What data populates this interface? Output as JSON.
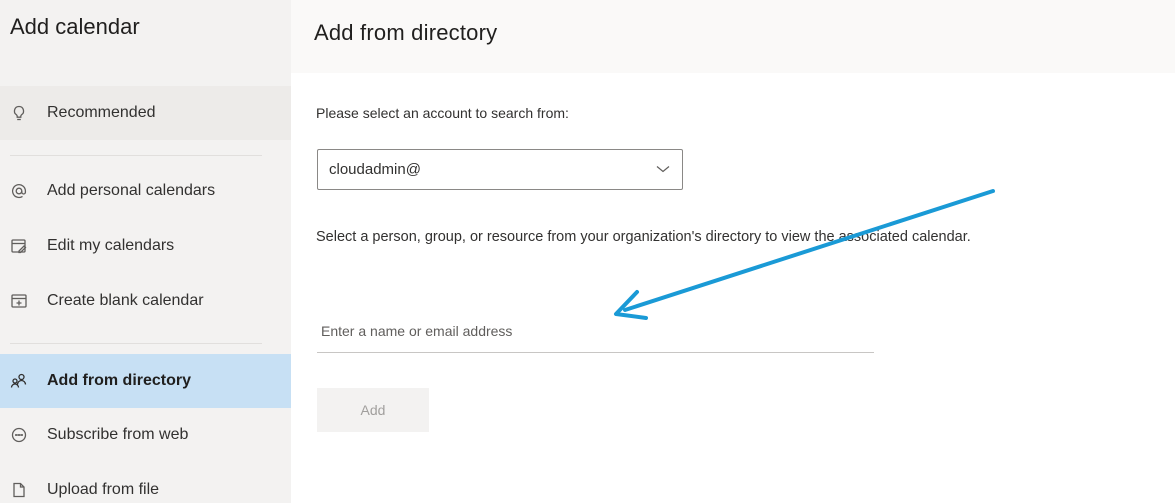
{
  "sidebar": {
    "title": "Add calendar",
    "items": [
      {
        "label": "Recommended",
        "icon": "lightbulb-icon"
      },
      {
        "label": "Add personal calendars",
        "icon": "at-icon"
      },
      {
        "label": "Edit my calendars",
        "icon": "calendar-edit-icon"
      },
      {
        "label": "Create blank calendar",
        "icon": "calendar-add-icon"
      },
      {
        "label": "Add from directory",
        "icon": "people-icon"
      },
      {
        "label": "Subscribe from web",
        "icon": "globe-icon"
      },
      {
        "label": "Upload from file",
        "icon": "file-icon"
      }
    ],
    "selected_item": "Add from directory"
  },
  "main": {
    "title": "Add from directory",
    "account_label": "Please select an account to search from:",
    "account_select": {
      "value": "cloudadmin@"
    },
    "instruction": "Select a person, group, or resource from your organization's directory to view the associated calendar.",
    "name_input": {
      "value": "",
      "placeholder": "Enter a name or email address"
    },
    "add_button_label": "Add"
  },
  "annotation": {
    "arrow_color": "#1a9ad6"
  },
  "colors": {
    "sidebar_bg": "#f3f2f1",
    "selected_bg": "#c7e0f4",
    "header_bg": "#faf9f8"
  }
}
